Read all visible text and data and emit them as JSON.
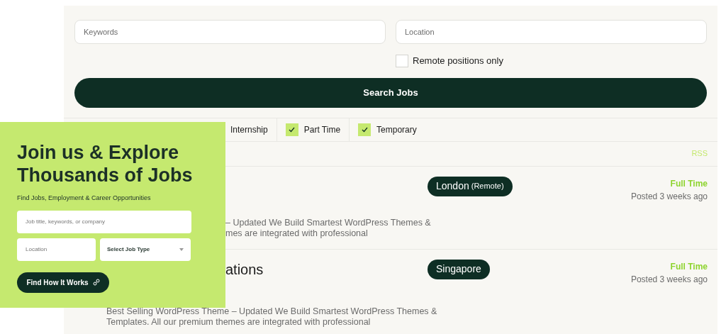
{
  "search": {
    "keywords_placeholder": "Keywords",
    "location_placeholder": "Location",
    "remote": {
      "label": "Remote positions only",
      "checked": false
    },
    "button": "Search Jobs"
  },
  "filters": [
    {
      "label": "Internship"
    },
    {
      "label": "Part Time",
      "checked": true
    },
    {
      "label": "Temporary",
      "checked": true
    }
  ],
  "rss": "RSS",
  "jobs": [
    {
      "location": "London",
      "location_note": "(Remote)",
      "type": "Full Time",
      "posted": "Posted 3 weeks ago",
      "description_lines": [
        {
          "text": "– Updated We Build Smartest WordPress Themes &",
          "partial": true
        },
        {
          "text": "mes are integrated with professional",
          "partial": true
        }
      ]
    },
    {
      "title": "ations",
      "location": "Singapore",
      "type": "Full Time",
      "posted": "Posted 3 weeks ago",
      "description_lines": [
        {
          "text": "Best Selling WordPress Theme – Updated We Build Smartest WordPress Themes &",
          "partial": false
        },
        {
          "text": "Templates. All our premium themes are integrated with professional",
          "partial": false
        }
      ]
    }
  ],
  "hero": {
    "heading_lines": [
      "Join us & Explore",
      "Thousands of Jobs"
    ],
    "subtitle": "Find Jobs, Employment & Career Opportunities",
    "job_placeholder": "Job title, keywords, or company",
    "location_placeholder": "Location",
    "job_type": "Select Job Type",
    "button": "Find How It Works"
  }
}
